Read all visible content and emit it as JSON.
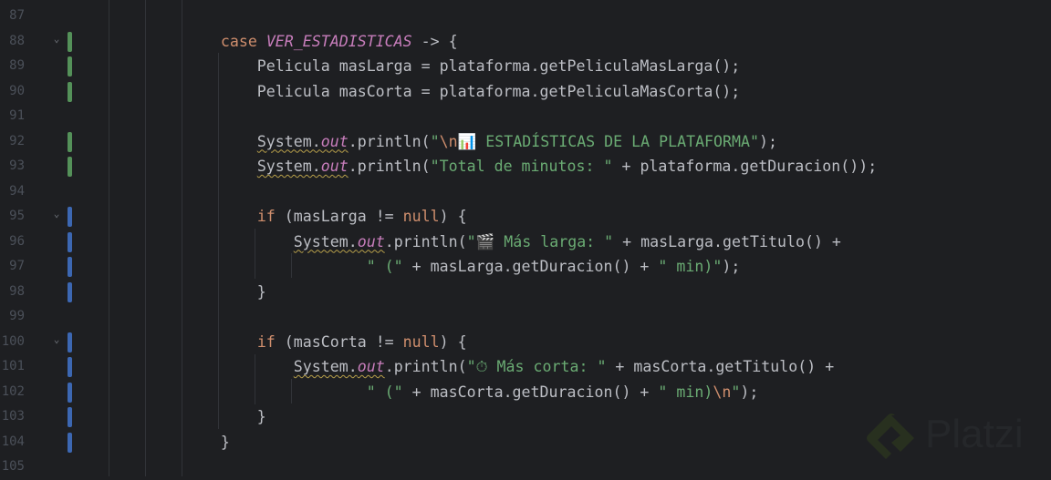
{
  "colors": {
    "keyword": "#cf8e6d",
    "constant": "#c77dbb",
    "text": "#bcbec4",
    "string": "#6aab73",
    "escape": "#cf8e6d",
    "added": "#549159",
    "modified": "#3c67b2"
  },
  "watermark": "Platzi",
  "lines": [
    {
      "num": "87",
      "fold": false,
      "change": null,
      "tokens": []
    },
    {
      "num": "88",
      "fold": true,
      "change": "added",
      "tokens": [
        {
          "t": "                "
        },
        {
          "t": "case ",
          "c": "keyword"
        },
        {
          "t": "VER_ESTADISTICAS",
          "c": "constant",
          "i": true
        },
        {
          "t": " -> {"
        }
      ]
    },
    {
      "num": "89",
      "fold": false,
      "change": "added",
      "tokens": [
        {
          "t": "                    Pelicula masLarga = plataforma.getPeliculaMasLarga();"
        }
      ]
    },
    {
      "num": "90",
      "fold": false,
      "change": "added",
      "tokens": [
        {
          "t": "                    Pelicula masCorta = plataforma.getPeliculaMasCorta();"
        }
      ]
    },
    {
      "num": "91",
      "fold": false,
      "change": null,
      "tokens": []
    },
    {
      "num": "92",
      "fold": false,
      "change": "added",
      "tokens": [
        {
          "t": "                    "
        },
        {
          "t": "System.",
          "w": true
        },
        {
          "t": "out",
          "c": "constant",
          "i": true,
          "w": true
        },
        {
          "t": ".println("
        },
        {
          "t": "\"",
          "c": "string"
        },
        {
          "t": "\\n",
          "c": "escape"
        },
        {
          "t": "📊 ESTADÍSTICAS DE LA PLATAFORMA\"",
          "c": "string"
        },
        {
          "t": ");"
        }
      ]
    },
    {
      "num": "93",
      "fold": false,
      "change": "added",
      "tokens": [
        {
          "t": "                    "
        },
        {
          "t": "System.",
          "w": true
        },
        {
          "t": "out",
          "c": "constant",
          "i": true,
          "w": true
        },
        {
          "t": ".println("
        },
        {
          "t": "\"Total de minutos: \"",
          "c": "string"
        },
        {
          "t": " + plataforma.getDuracion());"
        }
      ]
    },
    {
      "num": "94",
      "fold": false,
      "change": null,
      "tokens": []
    },
    {
      "num": "95",
      "fold": true,
      "change": "modified",
      "tokens": [
        {
          "t": "                    "
        },
        {
          "t": "if",
          "c": "keyword"
        },
        {
          "t": " (masLarga != "
        },
        {
          "t": "null",
          "c": "keyword"
        },
        {
          "t": ") {"
        }
      ]
    },
    {
      "num": "96",
      "fold": false,
      "change": "modified",
      "tokens": [
        {
          "t": "                        "
        },
        {
          "t": "System.",
          "w": true
        },
        {
          "t": "out",
          "c": "constant",
          "i": true,
          "w": true
        },
        {
          "t": ".println("
        },
        {
          "t": "\"🎬 Más larga: \"",
          "c": "string"
        },
        {
          "t": " + masLarga.getTitulo() +"
        }
      ]
    },
    {
      "num": "97",
      "fold": false,
      "change": "modified",
      "tokens": [
        {
          "t": "                                "
        },
        {
          "t": "\" (\"",
          "c": "string"
        },
        {
          "t": " + masLarga.getDuracion() + "
        },
        {
          "t": "\" min)\"",
          "c": "string"
        },
        {
          "t": ");"
        }
      ]
    },
    {
      "num": "98",
      "fold": false,
      "change": "modified",
      "tokens": [
        {
          "t": "                    }"
        }
      ]
    },
    {
      "num": "99",
      "fold": false,
      "change": null,
      "tokens": []
    },
    {
      "num": "100",
      "fold": true,
      "change": "modified",
      "tokens": [
        {
          "t": "                    "
        },
        {
          "t": "if",
          "c": "keyword"
        },
        {
          "t": " (masCorta != "
        },
        {
          "t": "null",
          "c": "keyword"
        },
        {
          "t": ") {"
        }
      ]
    },
    {
      "num": "101",
      "fold": false,
      "change": "modified",
      "tokens": [
        {
          "t": "                        "
        },
        {
          "t": "System.",
          "w": true
        },
        {
          "t": "out",
          "c": "constant",
          "i": true,
          "w": true
        },
        {
          "t": ".println("
        },
        {
          "t": "\"⏱ Más corta: \"",
          "c": "string"
        },
        {
          "t": " + masCorta.getTitulo() +"
        }
      ]
    },
    {
      "num": "102",
      "fold": false,
      "change": "modified",
      "tokens": [
        {
          "t": "                                "
        },
        {
          "t": "\" (\"",
          "c": "string"
        },
        {
          "t": " + masCorta.getDuracion() + "
        },
        {
          "t": "\" min)",
          "c": "string"
        },
        {
          "t": "\\n",
          "c": "escape"
        },
        {
          "t": "\"",
          "c": "string"
        },
        {
          "t": ");"
        }
      ]
    },
    {
      "num": "103",
      "fold": false,
      "change": "modified",
      "tokens": [
        {
          "t": "                    }"
        }
      ]
    },
    {
      "num": "104",
      "fold": false,
      "change": "modified",
      "tokens": [
        {
          "t": "                }"
        }
      ]
    },
    {
      "num": "105",
      "fold": false,
      "change": null,
      "tokens": []
    }
  ]
}
